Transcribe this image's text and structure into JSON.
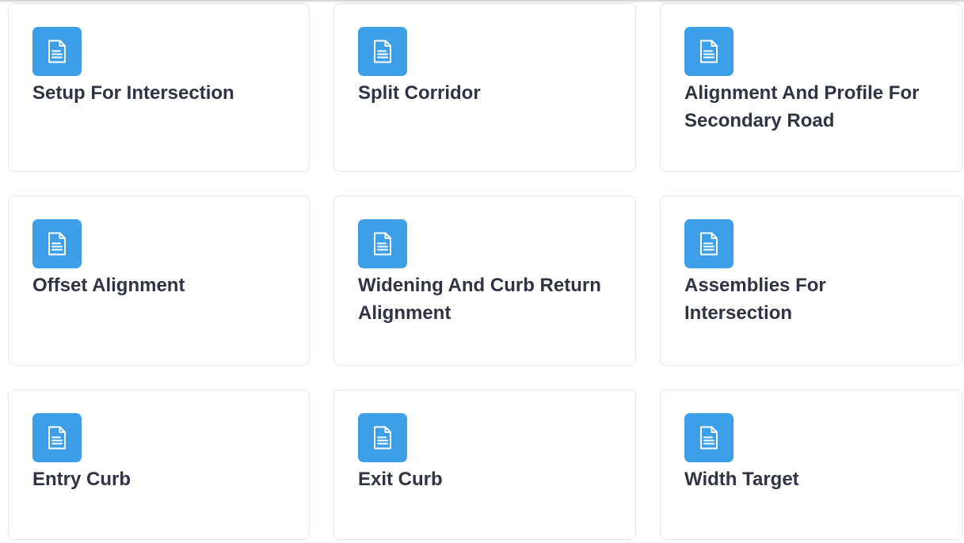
{
  "cards": [
    {
      "title": "Setup For Intersection",
      "icon": "document-icon"
    },
    {
      "title": "Split Corridor",
      "icon": "document-icon"
    },
    {
      "title": "Alignment And Profile For Secondary Road",
      "icon": "document-icon"
    },
    {
      "title": "Offset Alignment",
      "icon": "document-icon"
    },
    {
      "title": "Widening And Curb Return Alignment",
      "icon": "document-icon"
    },
    {
      "title": "Assemblies For Intersection",
      "icon": "document-icon"
    },
    {
      "title": "Entry Curb",
      "icon": "document-icon"
    },
    {
      "title": "Exit Curb",
      "icon": "document-icon"
    },
    {
      "title": "Width Target",
      "icon": "document-icon"
    }
  ],
  "colors": {
    "icon_tile": "#3c9fe8",
    "title_text": "#2e3442",
    "card_border": "#e3e6ea"
  }
}
